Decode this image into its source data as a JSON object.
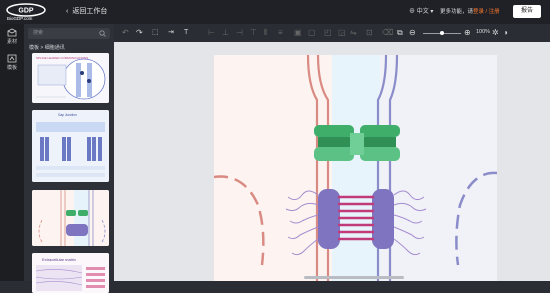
{
  "header": {
    "logo_text": "BioGDP.com",
    "back_label": "返回工作台",
    "language": "中文",
    "notice_prefix": "更多功能，请",
    "notice_link": "登录 / 注册",
    "publish_label": "报告"
  },
  "rail": {
    "items": [
      {
        "label": "素材",
        "icon": "box-icon"
      },
      {
        "label": "模板",
        "icon": "template-icon"
      }
    ]
  },
  "panel": {
    "search_placeholder": "搜索",
    "breadcrumb": "模板 > 细胞通讯",
    "thumbnails": [
      {
        "title": "SPLICE LEADER COMMUNICATIONS"
      },
      {
        "title": "Gap Junction"
      },
      {
        "title": ""
      },
      {
        "title": "Extracellular matrix"
      }
    ]
  },
  "toolbar": {
    "zoom": "100%"
  },
  "colors": {
    "accent": "#ff7a2f",
    "header_bg": "#1f2126",
    "membrane_left": "#d98a82",
    "membrane_right": "#8a8dc9",
    "connexin": "#3fae6b",
    "junction_protein": "#7e74c0",
    "strand": "#c13a7a"
  }
}
